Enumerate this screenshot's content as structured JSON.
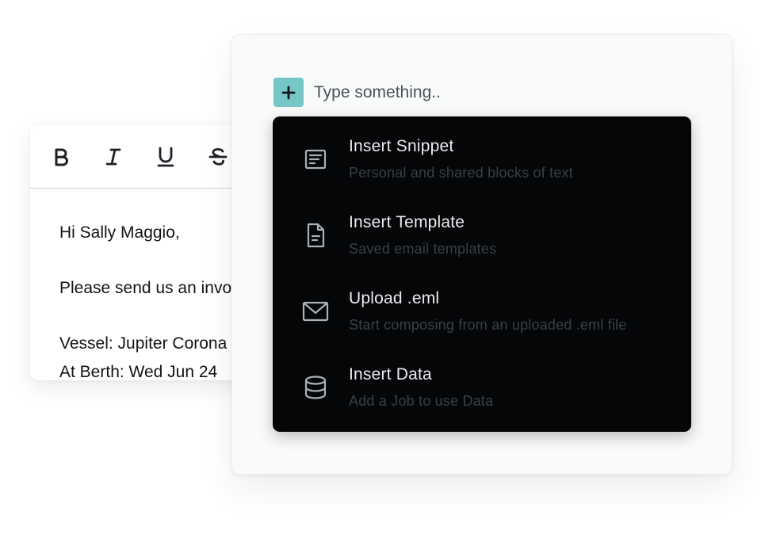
{
  "editor": {
    "toolbar": [
      {
        "name": "bold-button",
        "icon": "bold-icon"
      },
      {
        "name": "italic-button",
        "icon": "italic-icon"
      },
      {
        "name": "underline-button",
        "icon": "underline-icon"
      },
      {
        "name": "strikethrough-button",
        "icon": "strikethrough-icon"
      }
    ],
    "lines": [
      "Hi Sally Maggio,",
      "",
      "Please send us an invoice",
      "",
      "Vessel: Jupiter Corona",
      "At Berth: Wed Jun 24"
    ]
  },
  "palette": {
    "add_icon": "plus-icon",
    "add_color": "#74c6c7",
    "input_placeholder": "Type something..",
    "input_value": "",
    "menu": [
      {
        "icon": "snippet-icon",
        "title": "Insert Snippet",
        "description": "Personal and shared blocks of text"
      },
      {
        "icon": "template-file-icon",
        "title": "Insert Template",
        "description": "Saved email templates"
      },
      {
        "icon": "envelope-icon",
        "title": "Upload .eml",
        "description": "Start composing from an uploaded .eml file"
      },
      {
        "icon": "database-icon",
        "title": "Insert Data",
        "description": "Add a Job to use Data"
      }
    ]
  }
}
